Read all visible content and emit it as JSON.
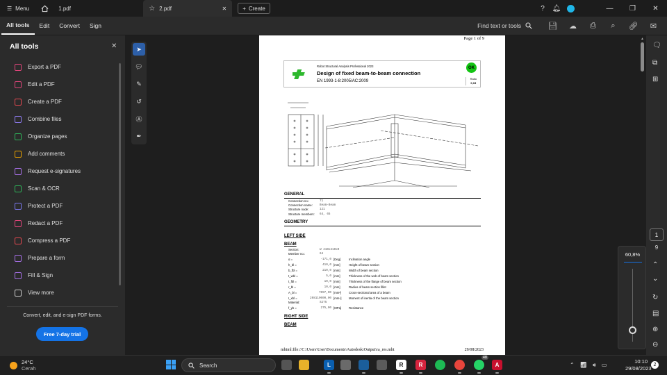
{
  "tabbar": {
    "menu_label": "Menu",
    "tabs": [
      {
        "label": "1.pdf"
      },
      {
        "label": "2.pdf"
      }
    ],
    "create_label": "Create"
  },
  "toolbar": {
    "menus": [
      "All tools",
      "Edit",
      "Convert",
      "Sign"
    ],
    "find_label": "Find text or tools"
  },
  "sidebar": {
    "title": "All tools",
    "items": [
      {
        "label": "Export a PDF",
        "color": "#e0457b"
      },
      {
        "label": "Edit a PDF",
        "color": "#e0457b"
      },
      {
        "label": "Create a PDF",
        "color": "#e34850"
      },
      {
        "label": "Combine files",
        "color": "#8f7cf2"
      },
      {
        "label": "Organize pages",
        "color": "#2fb35a"
      },
      {
        "label": "Add comments",
        "color": "#e7a000"
      },
      {
        "label": "Request e-signatures",
        "color": "#a770e8"
      },
      {
        "label": "Scan & OCR",
        "color": "#2fb35a"
      },
      {
        "label": "Protect a PDF",
        "color": "#7b79ef"
      },
      {
        "label": "Redact a PDF",
        "color": "#e0457b"
      },
      {
        "label": "Compress a PDF",
        "color": "#e34850"
      },
      {
        "label": "Prepare a form",
        "color": "#a770e8"
      },
      {
        "label": "Fill & Sign",
        "color": "#a770e8"
      },
      {
        "label": "View more",
        "color": "#cccccc"
      }
    ],
    "footer_text": "Convert, edit, and e-sign PDF forms.",
    "trial_label": "Free 7-day trial"
  },
  "document": {
    "page_label": "Page 1 of 9",
    "software": "Robot Structural Analysis Professional 2023",
    "title": "Design of fixed beam-to-beam connection",
    "code": "EN 1993-1-8:2005/AC:2009",
    "ok_label": "OK",
    "ratio_label": "Ratio",
    "ratio_value": "0,15",
    "general_heading": "GENERAL",
    "general_rows": [
      {
        "k": "Connection no.:",
        "v": "71"
      },
      {
        "k": "Connection name:",
        "v": "Beam-Beam"
      },
      {
        "k": "Structure node:",
        "v": "121"
      },
      {
        "k": "Structure members:",
        "v": "64, 65"
      }
    ],
    "geometry_heading": "GEOMETRY",
    "left_side_heading": "LEFT SIDE",
    "beam_heading": "BEAM",
    "beam_rows": [
      {
        "k": "Section:",
        "v": "W 410x210x0"
      },
      {
        "k": "Member no.:",
        "v": "64"
      }
    ],
    "params": [
      {
        "k": "α =",
        "v": "-171,0",
        "u": "[Deg]",
        "d": "Inclination angle"
      },
      {
        "k": "h_bl =",
        "v": "410,0",
        "u": "[mm]",
        "d": "Height of beam section"
      },
      {
        "k": "b_fbl =",
        "v": "210,0",
        "u": "[mm]",
        "d": "Width of beam section"
      },
      {
        "k": "t_wbl =",
        "v": "5,0",
        "u": "[mm]",
        "d": "Thickness of the web of beam section"
      },
      {
        "k": "t_fbl =",
        "v": "10,0",
        "u": "[mm]",
        "d": "Thickness of the flange of beam section"
      },
      {
        "k": "r_bl =",
        "v": "10,0",
        "u": "[mm]",
        "d": "Radius of beam section fillet"
      },
      {
        "k": "A_bl =",
        "v": "7097,00",
        "u": "[mm²]",
        "d": "Cross-sectional area of a beam"
      },
      {
        "k": "I_xbl =",
        "v": "208110000,00",
        "u": "[mm⁴]",
        "d": "Moment of inertia of the beam section"
      }
    ],
    "material_row": {
      "k": "Material:",
      "v": "S275"
    },
    "fy_row": {
      "k": "f_yb =",
      "v": "275,00",
      "u": "[MPa]",
      "d": "Resistance"
    },
    "right_side_heading": "RIGHT SIDE",
    "beam2_heading": "BEAM",
    "footer_path": "mhtml:file://C:\\Users\\User\\Documents\\Autodesk\\Output\\ra_res.mht",
    "footer_date": "29/08/2023"
  },
  "right_panel": {
    "current_page": "1",
    "total_pages": "9",
    "zoom": "60,8%"
  },
  "taskbar": {
    "temp": "24°C",
    "weather": "Cerah",
    "search_label": "Search",
    "badge": "48",
    "time": "10:10",
    "date": "29/08/2023",
    "notification_count": "2"
  }
}
